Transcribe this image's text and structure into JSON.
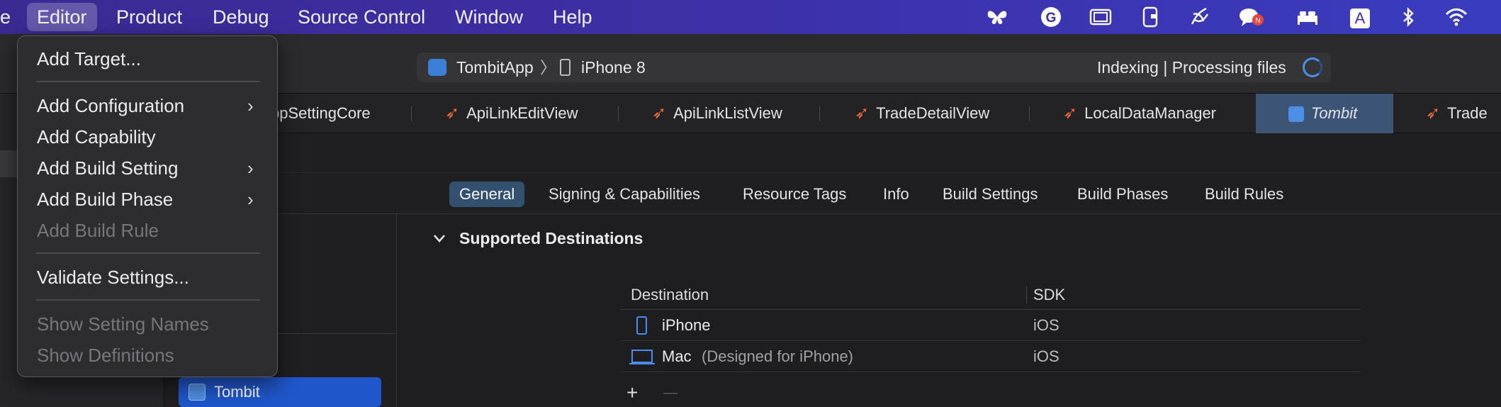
{
  "menubar": {
    "left_fragment": "e",
    "items": [
      "Editor",
      "Product",
      "Debug",
      "Source Control",
      "Window",
      "Help"
    ]
  },
  "status_icons": [
    "butterfly-icon",
    "grammarly-icon",
    "screen-icon",
    "phone-link-icon",
    "brush-icon",
    "notification-icon",
    "bed-icon",
    "input-source-icon",
    "bluetooth-icon",
    "wifi-icon"
  ],
  "input_source_label": "A",
  "scheme": {
    "app": "TombitApp",
    "separator": "〉",
    "device": "iPhone 8",
    "status": "Indexing | Processing files"
  },
  "tabs": [
    "ppSettingCore",
    "ApiLinkEditView",
    "ApiLinkListView",
    "TradeDetailView",
    "LocalDataManager",
    "Tombit",
    "Trade"
  ],
  "segments": [
    "General",
    "Signing & Capabilities",
    "Resource Tags",
    "Info",
    "Build Settings",
    "Build Phases",
    "Build Rules"
  ],
  "section": {
    "title": "Supported Destinations"
  },
  "table": {
    "headers": [
      "Destination",
      "SDK"
    ],
    "rows": [
      {
        "destination": "iPhone",
        "suffix": "",
        "sdk": "iOS"
      },
      {
        "destination": "Mac",
        "suffix": "(Designed for iPhone)",
        "sdk": "iOS"
      }
    ],
    "add_label": "+",
    "remove_label": "—"
  },
  "target": {
    "name": "Tombit"
  },
  "editor_menu": {
    "items": [
      {
        "label": "Add Target...",
        "enabled": true,
        "submenu": false
      },
      {
        "label": "Add Configuration",
        "enabled": true,
        "submenu": true
      },
      {
        "label": "Add Capability",
        "enabled": true,
        "submenu": false
      },
      {
        "label": "Add Build Setting",
        "enabled": true,
        "submenu": true
      },
      {
        "label": "Add Build Phase",
        "enabled": true,
        "submenu": true
      },
      {
        "label": "Add Build Rule",
        "enabled": false,
        "submenu": false
      },
      {
        "label": "Validate Settings...",
        "enabled": true,
        "submenu": false
      },
      {
        "label": "Show Setting Names",
        "enabled": false,
        "submenu": false
      },
      {
        "label": "Show Definitions",
        "enabled": false,
        "submenu": false
      }
    ],
    "chevron": "›"
  },
  "colors": {
    "menubar": "#3b2fa6",
    "accent_selection": "#1f56c9",
    "segment_active": "#34506f",
    "swift_orange": "#f06a35"
  }
}
